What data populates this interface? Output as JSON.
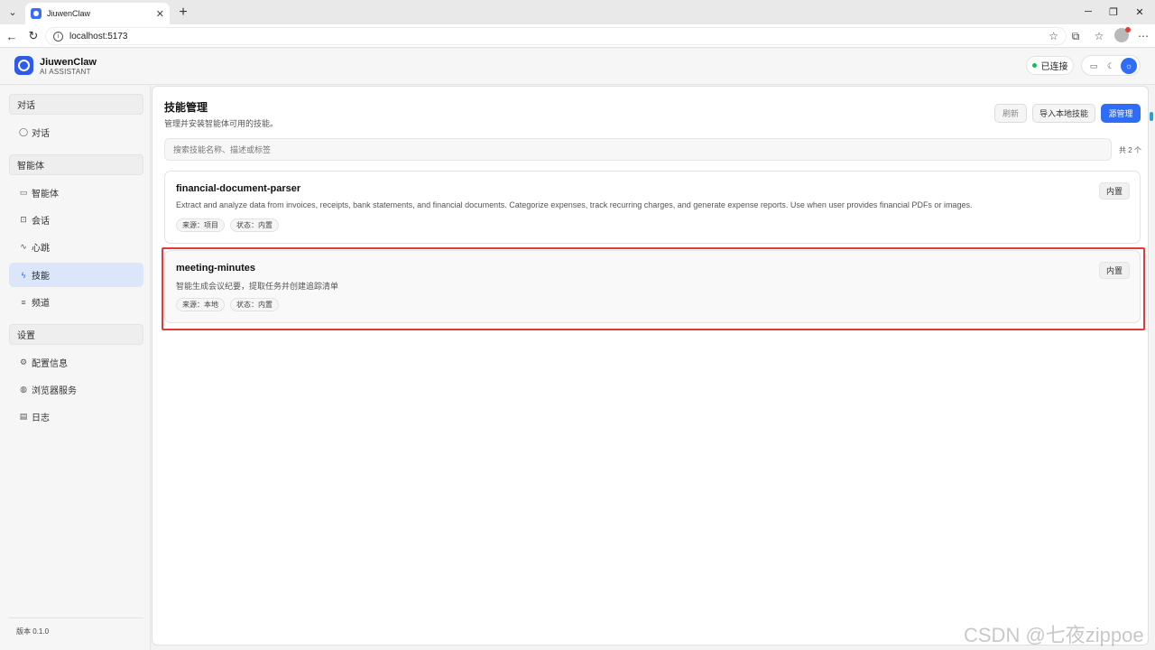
{
  "browser": {
    "tab_title": "JiuwenClaw",
    "url": "localhost:5173",
    "tab_close": "✕",
    "new_tab": "+"
  },
  "header": {
    "brand_name": "JiuwenClaw",
    "brand_sub": "AI ASSISTANT",
    "status_text": "已连接",
    "status_color": "#1db954",
    "accent_color": "#2f6df6"
  },
  "sidebar": {
    "sections": [
      {
        "label": "对话"
      },
      {
        "label": "智能体"
      },
      {
        "label": "设置"
      }
    ],
    "items": [
      {
        "label": "对话",
        "icon": "chat-bubble-icon"
      },
      {
        "label": "智能体",
        "icon": "monitor-icon"
      },
      {
        "label": "会话",
        "icon": "session-icon"
      },
      {
        "label": "心跳",
        "icon": "heartbeat-icon"
      },
      {
        "label": "技能",
        "icon": "lightning-icon",
        "active": true
      },
      {
        "label": "频道",
        "icon": "menu-lines-icon"
      },
      {
        "label": "配置信息",
        "icon": "gear-icon"
      },
      {
        "label": "浏览器服务",
        "icon": "globe-icon"
      },
      {
        "label": "日志",
        "icon": "document-icon"
      }
    ],
    "version": "版本 0.1.0"
  },
  "main": {
    "title": "技能管理",
    "subtitle": "管理并安装智能体可用的技能。",
    "buttons": {
      "refresh": "刷新",
      "import": "导入本地技能",
      "source": "源管理"
    },
    "search_placeholder": "搜索技能名称、描述或标签",
    "total": "共 2 个",
    "skills": [
      {
        "name": "financial-document-parser",
        "description": "Extract and analyze data from invoices, receipts, bank statements, and financial documents. Categorize expenses, track recurring charges, and generate expense reports. Use when user provides financial PDFs or images.",
        "tags": [
          "来源：项目",
          "状态：内置"
        ],
        "badge": "内置"
      },
      {
        "name": "meeting-minutes",
        "description": "智能生成会议纪要，提取任务并创建追踪清单",
        "tags": [
          "来源：本地",
          "状态：内置"
        ],
        "badge": "内置"
      }
    ]
  },
  "watermark": "CSDN @七夜zippoe"
}
